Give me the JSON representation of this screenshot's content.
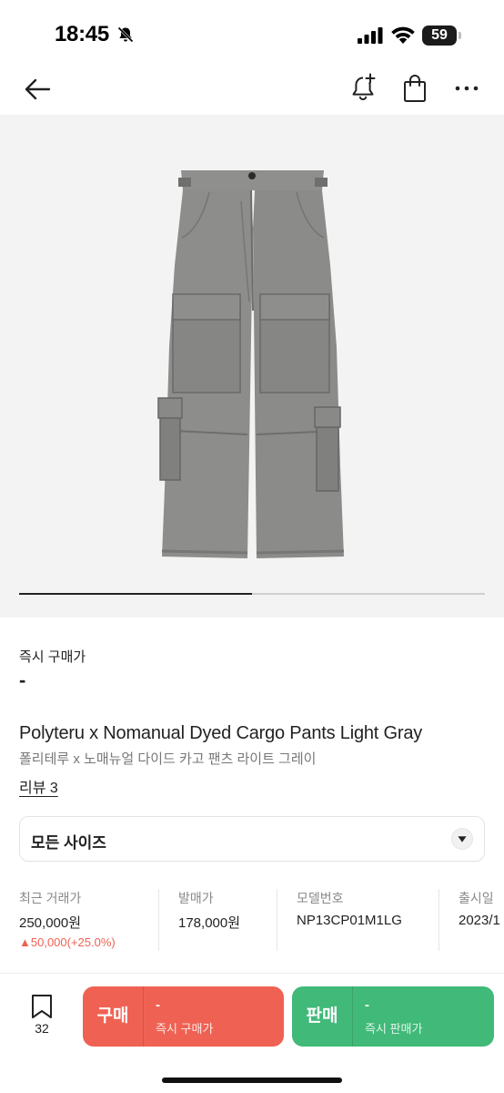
{
  "status_bar": {
    "time": "18:45",
    "battery_level": "59",
    "icons": [
      "bell-slash-icon",
      "cellular-signal-icon",
      "wifi-icon",
      "battery-icon"
    ]
  },
  "nav": {
    "icons": [
      "back-arrow-icon",
      "bell-plus-icon",
      "shopping-bag-icon",
      "more-icon"
    ]
  },
  "gallery": {
    "image_alt": "Polyteru x Nomanual Dyed Cargo Pants Light Gray",
    "progress": 0.5
  },
  "product": {
    "instant_price_label": "즉시 구매가",
    "instant_price_value": "-",
    "title_en": "Polyteru x Nomanual Dyed Cargo Pants Light Gray",
    "title_ko": "폴리테루 x 노매뉴얼 다이드 카고 팬츠 라이트 그레이",
    "review_link": "리뷰 3"
  },
  "size_select": {
    "label": "모든 사이즈",
    "icon": "chevron-down-icon"
  },
  "info": {
    "recent_trade": {
      "label": "최근 거래가",
      "value": "250,000원",
      "change": "▲50,000(+25.0%)"
    },
    "release_price": {
      "label": "발매가",
      "value": "178,000원"
    },
    "model_number": {
      "label": "모델번호",
      "value": "NP13CP01M1LG"
    },
    "release_date": {
      "label": "출시일",
      "value": "2023/1"
    }
  },
  "bottom_bar": {
    "bookmark_count": "32",
    "buy": {
      "label": "구매",
      "price": "-",
      "sub": "즉시 구매가"
    },
    "sell": {
      "label": "판매",
      "price": "-",
      "sub": "즉시 판매가"
    }
  },
  "colors": {
    "buy": "#ef6253",
    "sell": "#41b979",
    "price_change": "#ef6253"
  }
}
